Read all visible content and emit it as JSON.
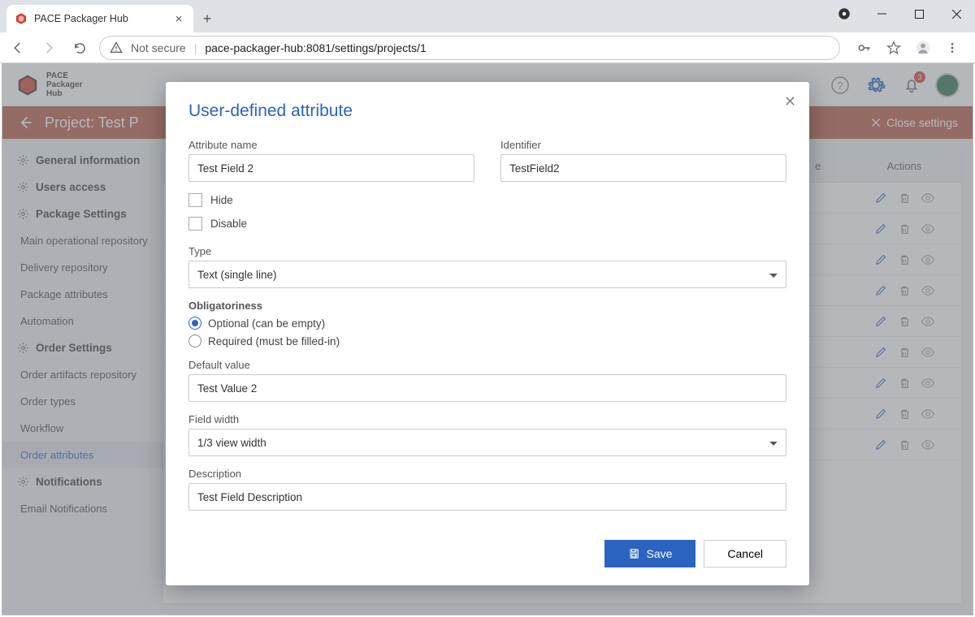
{
  "browser": {
    "tab_title": "PACE Packager Hub",
    "not_secure": "Not secure",
    "url": "pace-packager-hub:8081/settings/projects/1"
  },
  "app": {
    "brand_lines": [
      "PACE",
      "Packager",
      "Hub"
    ],
    "project_title": "Project: Test P",
    "close_settings": "Close settings",
    "notification_count": "3"
  },
  "sidebar": {
    "items": [
      {
        "label": "General information",
        "type": "head"
      },
      {
        "label": "Users access",
        "type": "head"
      },
      {
        "label": "Package Settings",
        "type": "head"
      },
      {
        "label": "Main operational repository",
        "type": "sub"
      },
      {
        "label": "Delivery repository",
        "type": "sub"
      },
      {
        "label": "Package attributes",
        "type": "sub"
      },
      {
        "label": "Automation",
        "type": "sub"
      },
      {
        "label": "Order Settings",
        "type": "head"
      },
      {
        "label": "Order artifacts repository",
        "type": "sub"
      },
      {
        "label": "Order types",
        "type": "sub"
      },
      {
        "label": "Workflow",
        "type": "sub"
      },
      {
        "label": "Order attributes",
        "type": "sub",
        "active": true
      },
      {
        "label": "Notifications",
        "type": "head"
      },
      {
        "label": "Email Notifications",
        "type": "sub"
      }
    ]
  },
  "table": {
    "col_e": "e",
    "col_actions": "Actions",
    "row_count": 9
  },
  "modal": {
    "title": "User-defined attribute",
    "attr_name_label": "Attribute name",
    "attr_name_value": "Test Field 2",
    "identifier_label": "Identifier",
    "identifier_value": "TestField2",
    "hide_label": "Hide",
    "disable_label": "Disable",
    "type_label": "Type",
    "type_value": "Text (single line)",
    "oblig_label": "Obligatoriness",
    "optional_label": "Optional (can be empty)",
    "required_label": "Required (must be filled-in)",
    "default_label": "Default value",
    "default_value": "Test Value 2",
    "width_label": "Field width",
    "width_value": "1/3 view width",
    "desc_label": "Description",
    "desc_value": "Test Field Description",
    "save": "Save",
    "cancel": "Cancel"
  }
}
